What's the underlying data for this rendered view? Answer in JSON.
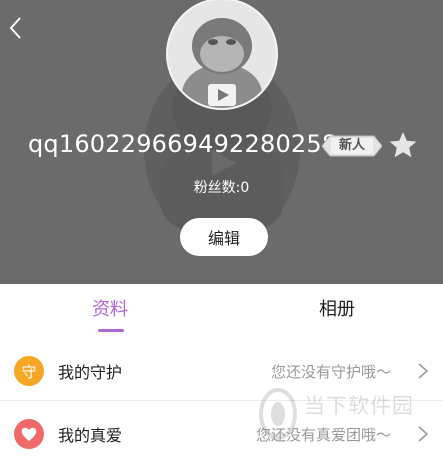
{
  "header": {
    "back_icon": "back-chevron-icon",
    "avatar_icon": "gorilla-avatar-icon",
    "username": "qq160229669492280258",
    "badge_label": "新人",
    "star_icon": "star-icon",
    "fans_text": "粉丝数:0",
    "edit_label": "编辑"
  },
  "tabs": [
    {
      "label": "资料",
      "active": true
    },
    {
      "label": "相册",
      "active": false
    }
  ],
  "rows": [
    {
      "icon": "guard-icon",
      "icon_char": "守",
      "label": "我的守护",
      "value": "您还没有守护哦～"
    },
    {
      "icon": "heart-icon",
      "label": "我的真爱",
      "value": "您还没有真爱团哦～"
    }
  ],
  "watermark": {
    "text": "当下软件园"
  },
  "colors": {
    "accent": "#b066d9",
    "header_bg": "#6b6b6b",
    "guard_orange": "#f5a623",
    "heart_red": "#f06a6a"
  }
}
